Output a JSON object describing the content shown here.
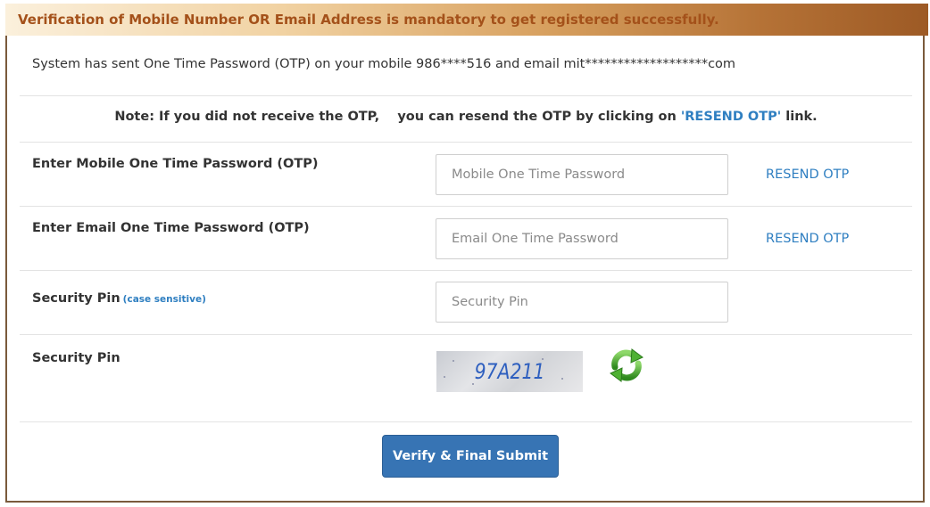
{
  "banner": {
    "text": "Verification of Mobile Number OR Email Address is mandatory to get registered successfully."
  },
  "info": {
    "otp_sent_text": "System has sent One Time Password (OTP) on your mobile 986****516 and email mit*******************com"
  },
  "note": {
    "prefix": "Note: If you did not receive the OTP,    you can resend the OTP by clicking on ",
    "link_text": "'RESEND OTP'",
    "suffix": " link."
  },
  "form": {
    "mobile_otp": {
      "label": "Enter Mobile One Time Password (OTP)",
      "placeholder": "Mobile One Time Password",
      "value": "",
      "resend_label": "RESEND OTP"
    },
    "email_otp": {
      "label": "Enter Email One Time Password (OTP)",
      "placeholder": "Email One Time Password",
      "value": "",
      "resend_label": "RESEND OTP"
    },
    "security_pin": {
      "label": "Security Pin",
      "hint": "(case sensitive)",
      "placeholder": "Security Pin",
      "value": ""
    },
    "captcha": {
      "label": "Security Pin",
      "code": "97A211",
      "refresh_icon": "refresh-icon"
    }
  },
  "actions": {
    "submit_label": "Verify & Final Submit"
  },
  "colors": {
    "accent_link": "#2f7fc1",
    "button": "#3774b4",
    "banner_text": "#a4511a",
    "panel_border": "#7a5a3c",
    "refresh_green": "#3a9a2a"
  }
}
